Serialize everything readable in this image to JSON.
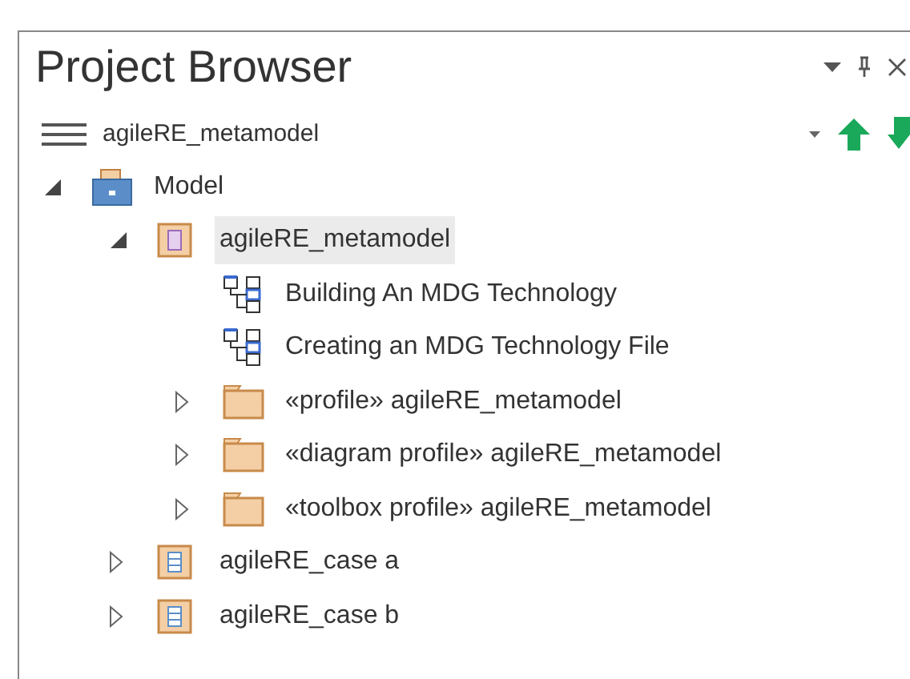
{
  "title": "Project Browser",
  "toolbar": {
    "package": "agileRE_metamodel"
  },
  "tree": [
    {
      "kind": "model",
      "label": "Model",
      "expanded": true,
      "selected": false,
      "children": [
        {
          "kind": "package",
          "label": "agileRE_metamodel",
          "expanded": true,
          "selected": true,
          "children": [
            {
              "kind": "diagram",
              "label": "Building An MDG Technology",
              "selected": false
            },
            {
              "kind": "diagram",
              "label": "Creating an MDG Technology File",
              "selected": false
            },
            {
              "kind": "folder",
              "label": "«profile» agileRE_metamodel",
              "expanded": false,
              "selected": false
            },
            {
              "kind": "folder",
              "label": "«diagram profile» agileRE_metamodel",
              "expanded": false,
              "selected": false
            },
            {
              "kind": "folder",
              "label": "«toolbox profile» agileRE_metamodel",
              "expanded": false,
              "selected": false
            }
          ]
        },
        {
          "kind": "class",
          "label": "agileRE_case a",
          "expanded": false,
          "selected": false
        },
        {
          "kind": "class",
          "label": "agileRE_case b",
          "expanded": false,
          "selected": false
        }
      ]
    }
  ]
}
